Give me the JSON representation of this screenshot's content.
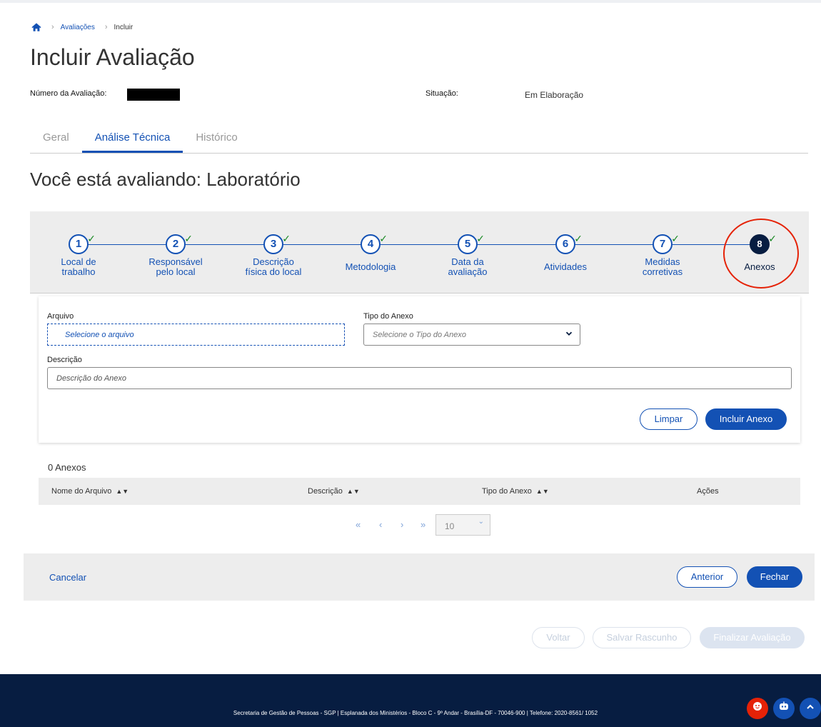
{
  "breadcrumb": {
    "items": [
      "Avaliações",
      "Incluir"
    ]
  },
  "page": {
    "title": "Incluir Avaliação",
    "subtitle": "Você está avaliando: Laboratório"
  },
  "meta": {
    "numero_label": "Número da Avaliação:",
    "situacao_label": "Situação:",
    "situacao_value": "Em Elaboração"
  },
  "tabs": [
    {
      "label": "Geral",
      "active": false
    },
    {
      "label": "Análise Técnica",
      "active": true
    },
    {
      "label": "Histórico",
      "active": false
    }
  ],
  "stepper": {
    "steps": [
      {
        "number": "1",
        "line1": "Local de",
        "line2": "trabalho",
        "completed": true
      },
      {
        "number": "2",
        "line1": "Responsável",
        "line2": "pelo local",
        "completed": true
      },
      {
        "number": "3",
        "line1": "Descrição",
        "line2": "física do local",
        "completed": true
      },
      {
        "number": "4",
        "line1": "Metodologia",
        "line2": "",
        "completed": true
      },
      {
        "number": "5",
        "line1": "Data da",
        "line2": "avaliação",
        "completed": true
      },
      {
        "number": "6",
        "line1": "Atividades",
        "line2": "",
        "completed": true
      },
      {
        "number": "7",
        "line1": "Medidas",
        "line2": "corretivas",
        "completed": true
      },
      {
        "number": "8",
        "line1": "Anexos",
        "line2": "",
        "completed": true,
        "active": true
      }
    ],
    "check_glyph": "✓"
  },
  "form": {
    "arquivo_label": "Arquivo",
    "arquivo_placeholder": "Selecione o arquivo",
    "tipo_label": "Tipo do Anexo",
    "tipo_placeholder": "Selecione o Tipo do Anexo",
    "descricao_label": "Descrição",
    "descricao_placeholder": "Descrição do Anexo",
    "limpar_label": "Limpar",
    "incluir_label": "Incluir Anexo"
  },
  "table": {
    "count_label": "0 Anexos",
    "columns": [
      "Nome do Arquivo",
      "Descrição",
      "Tipo do Anexo",
      "Ações"
    ]
  },
  "pagination": {
    "page_size": "10"
  },
  "actions": {
    "cancelar": "Cancelar",
    "anterior": "Anterior",
    "fechar": "Fechar",
    "voltar": "Voltar",
    "salvar_rascunho": "Salvar Rascunho",
    "finalizar": "Finalizar Avaliação"
  },
  "footer": {
    "text": "Secretaria de Gestão de Pessoas - SGP | Esplanada dos Ministérios - Bloco C - 9º Andar - Brasília-DF - 70046-900 | Telefone: 2020-8561/ 1052"
  },
  "colors": {
    "primary": "#1351b4",
    "dark": "#071d41",
    "success": "#168821",
    "danger": "#e52207"
  }
}
